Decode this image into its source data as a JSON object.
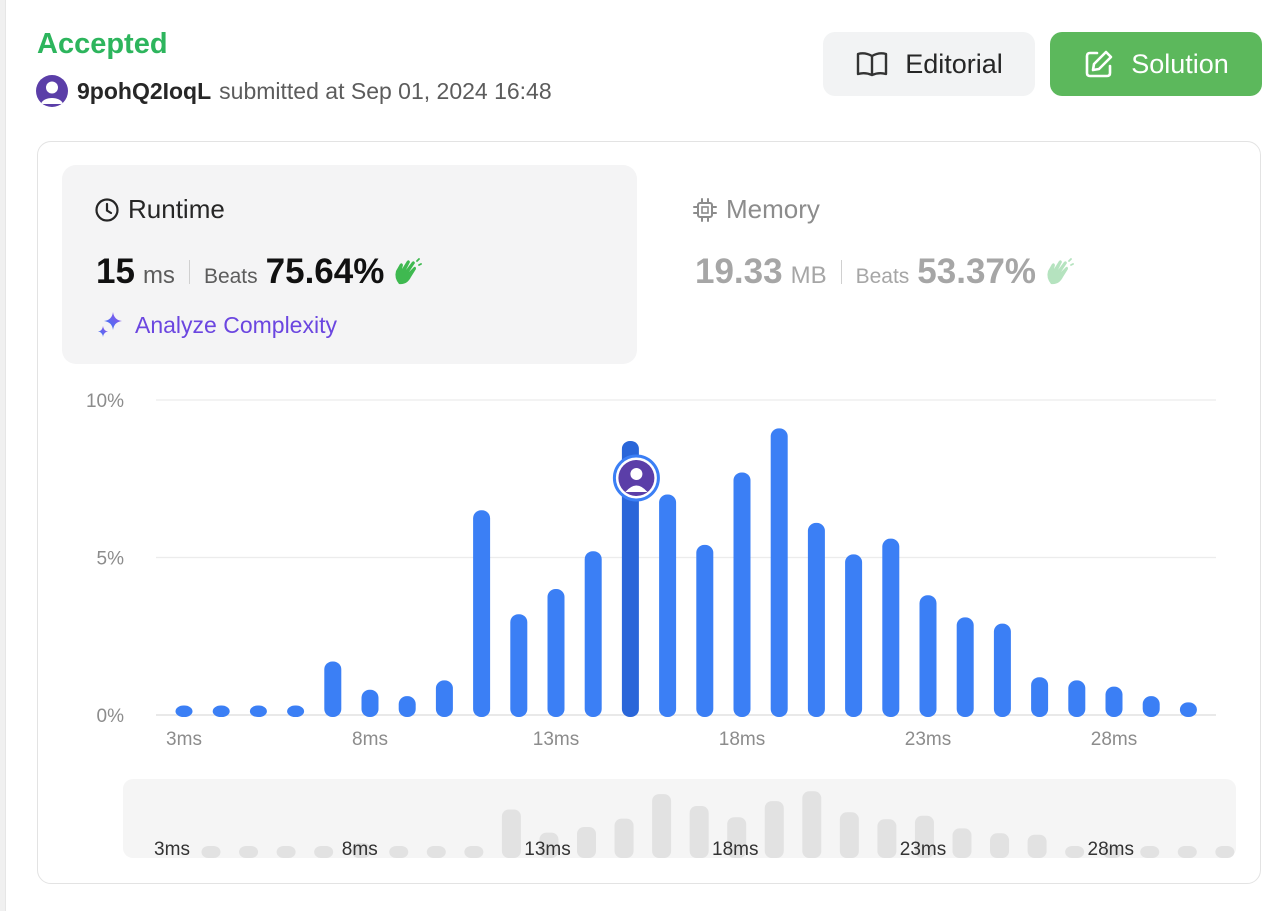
{
  "status": "Accepted",
  "submission": {
    "username": "9pohQ2IoqL",
    "text": "submitted at Sep 01, 2024 16:48"
  },
  "buttons": {
    "editorial": "Editorial",
    "solution": "Solution"
  },
  "runtime": {
    "title": "Runtime",
    "value": "15",
    "unit": "ms",
    "beats_label": "Beats",
    "beats": "75.64%",
    "analyze_label": "Analyze Complexity"
  },
  "memory": {
    "title": "Memory",
    "value": "19.33",
    "unit": "MB",
    "beats_label": "Beats",
    "beats": "53.37%"
  },
  "colors": {
    "accepted": "#2db55d",
    "bar": "#3b7ff5",
    "bar_selected": "#2a66d9",
    "solution_button": "#5cb85c",
    "analyze": "#6b46e0",
    "avatar": "#5b3ea8"
  },
  "chart_data": {
    "type": "bar",
    "x_unit": "ms",
    "x": [
      3,
      4,
      5,
      6,
      7,
      8,
      9,
      10,
      11,
      12,
      13,
      14,
      15,
      16,
      17,
      18,
      19,
      20,
      21,
      22,
      23,
      24,
      25,
      26,
      27,
      28,
      29,
      30
    ],
    "values": [
      0.3,
      0.3,
      0.3,
      0.3,
      1.7,
      0.8,
      0.6,
      1.1,
      6.5,
      3.2,
      4.0,
      5.2,
      8.7,
      7.0,
      5.4,
      7.7,
      9.1,
      6.1,
      5.1,
      5.6,
      3.8,
      3.1,
      2.9,
      1.2,
      1.1,
      0.9,
      0.6,
      0.4
    ],
    "selected_x": 15,
    "ylim": [
      0,
      10
    ],
    "yticks": [
      "0%",
      "5%",
      "10%"
    ],
    "xticks": [
      "3ms",
      "8ms",
      "13ms",
      "18ms",
      "23ms",
      "28ms"
    ],
    "grid": true,
    "overview_xticks": [
      "3ms",
      "8ms",
      "13ms",
      "18ms",
      "23ms",
      "28ms"
    ]
  }
}
